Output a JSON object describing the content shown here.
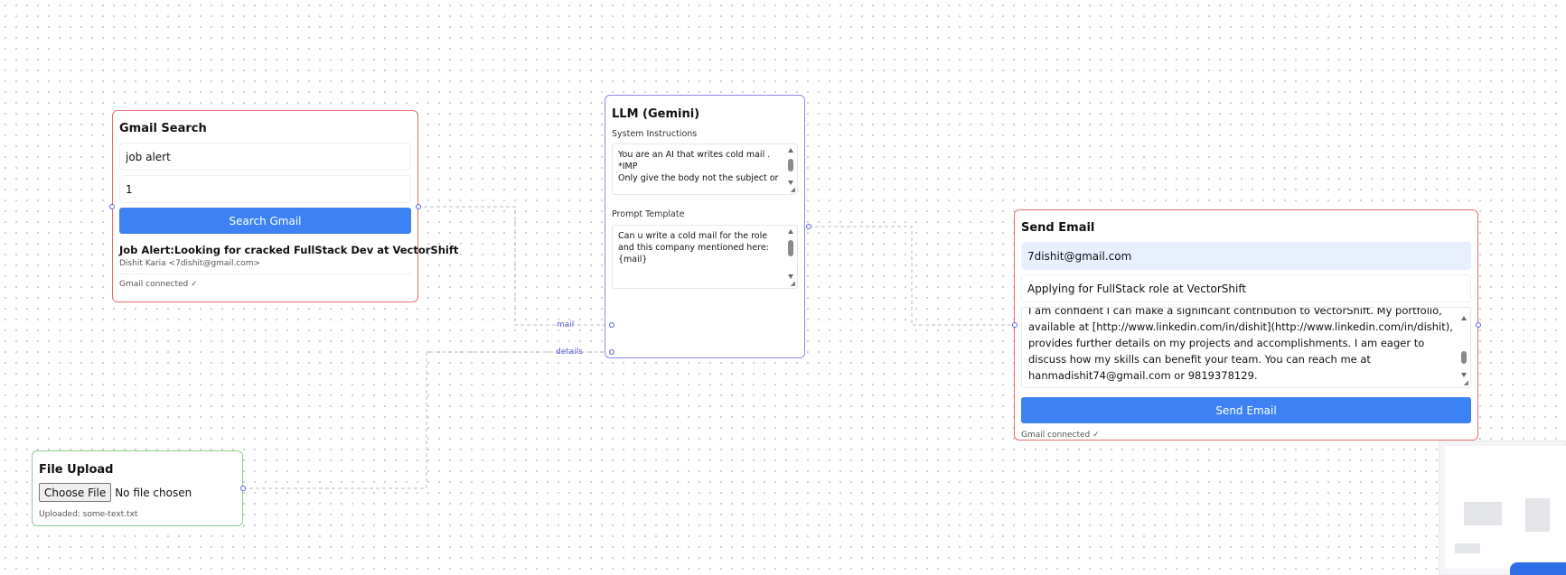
{
  "gmail_search": {
    "title": "Gmail Search",
    "query_value": "job alert",
    "count_value": "1",
    "button_label": "Search Gmail",
    "result_subject": "Job Alert:Looking for cracked FullStack Dev at VectorShift",
    "result_from": "Dishit Karia <7dishit@gmail.com>",
    "status": "Gmail connected ✓"
  },
  "llm": {
    "title": "LLM (Gemini)",
    "system_label": "System Instructions",
    "system_text": "You are an AI that writes cold mail .\n*IMP\nOnly give the body not the subject or",
    "prompt_label": "Prompt Template",
    "prompt_text": "Can u write a cold mail for the role and this company mentioned here:\n{mail}"
  },
  "edges": {
    "mail_label": "mail",
    "details_label": "details"
  },
  "send_email": {
    "title": "Send Email",
    "to_value": "7dishit@gmail.com",
    "subject_value": "Applying for FullStack role at VectorShift",
    "body_text": "I am confident I can make a significant contribution to VectorShift. My portfolio, available at [http://www.linkedin.com/in/dishit](http://www.linkedin.com/in/dishit), provides further details on my projects and accomplishments. I am eager to discuss how my skills can benefit your team.  You can reach me at hanmadishit74@gmail.com or 9819378129.",
    "button_label": "Send Email",
    "status": "Gmail connected ✓"
  },
  "file_upload": {
    "title": "File Upload",
    "choose_label": "Choose File",
    "no_file_label": "No file chosen",
    "uploaded_text": "Uploaded: some-text.txt"
  },
  "colors": {
    "accent_blue": "#3d82f2",
    "gmail_border": "#e86e6e",
    "llm_border": "#8e88e8",
    "upload_border": "#8ccc8c",
    "handle": "#5b5fd6",
    "edge": "#b8bcc4"
  }
}
